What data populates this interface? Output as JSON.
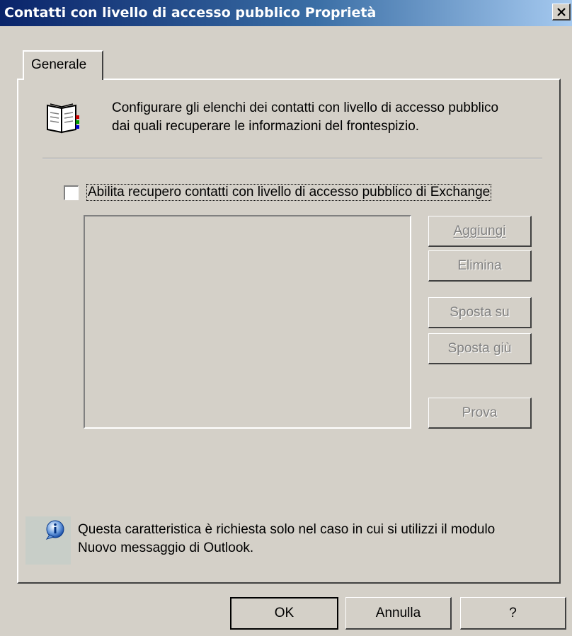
{
  "window": {
    "title": "Contatti con livello di accesso pubblico Proprietà",
    "close_glyph": "✕"
  },
  "tabs": [
    {
      "label": "Generale",
      "active": true
    }
  ],
  "description": {
    "line1": "Configurare gli elenchi dei contatti con livello di accesso pubblico",
    "line2": "dai quali recuperare le informazioni del frontespizio.",
    "icon": "book-icon"
  },
  "enable_checkbox": {
    "label": "Abilita recupero contatti con livello di accesso pubblico di Exchange",
    "checked": false
  },
  "side_buttons": {
    "add": "Aggiungi",
    "delete": "Elimina",
    "move_up": "Sposta su",
    "move_down": "Sposta giù",
    "test": "Prova"
  },
  "info_note": {
    "line1": "Questa caratteristica è richiesta solo nel caso in cui si utilizzi il modulo",
    "line2": "Nuovo messaggio di Outlook.",
    "icon": "info-icon"
  },
  "footer_buttons": {
    "ok": "OK",
    "cancel": "Annulla",
    "help": "?"
  }
}
